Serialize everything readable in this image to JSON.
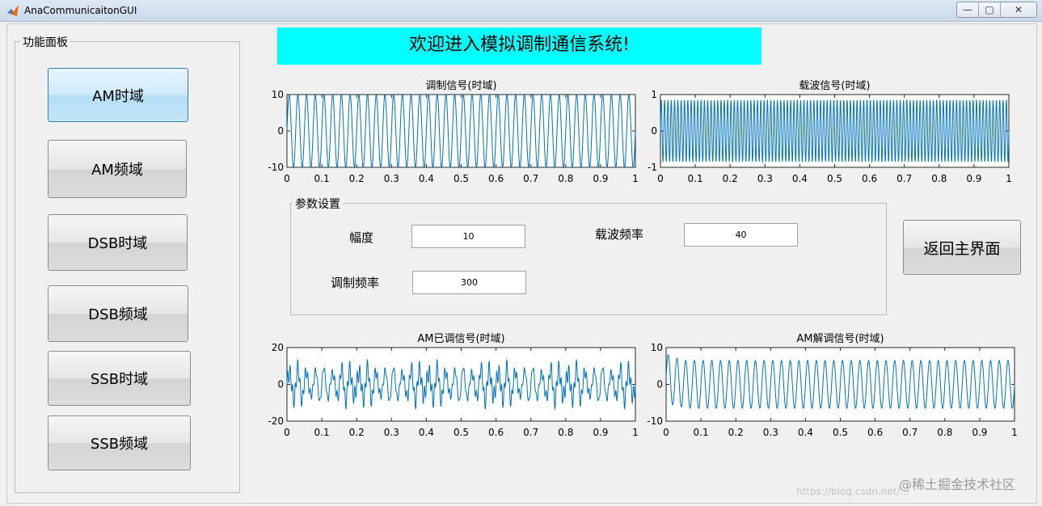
{
  "window": {
    "title": "AnaCommunicaitonGUI",
    "controls": [
      "—",
      "▢",
      "✕"
    ]
  },
  "function_panel": {
    "title": "功能面板",
    "buttons": [
      {
        "label": "AM时域",
        "active": true
      },
      {
        "label": "AM频域",
        "active": false
      },
      {
        "label": "DSB时域",
        "active": false
      },
      {
        "label": "DSB频域",
        "active": false
      },
      {
        "label": "SSB时域",
        "active": false
      },
      {
        "label": "SSB频域",
        "active": false
      }
    ]
  },
  "banner": {
    "text": "欢迎进入模拟调制通信系统!",
    "color": "#00ffff"
  },
  "params": {
    "title": "参数设置",
    "amplitude_label": "幅度",
    "amplitude_value": "10",
    "carrier_freq_label": "载波频率",
    "carrier_freq_value": "40",
    "mod_freq_label": "调制频率",
    "mod_freq_value": "300"
  },
  "return_button": {
    "label": "返回主界面"
  },
  "chart_data": [
    {
      "type": "line",
      "title": "调制信号(时域)",
      "xlim": [
        0,
        1
      ],
      "ylim": [
        -10,
        10
      ],
      "xticks": [
        "0",
        "0.1",
        "0.2",
        "0.3",
        "0.4",
        "0.5",
        "0.6",
        "0.7",
        "0.8",
        "0.9",
        "1"
      ],
      "yticks": [
        "10",
        "0",
        "-10"
      ],
      "series": [
        {
          "color": "#0072bd",
          "amplitude": 10,
          "cycles": 40
        }
      ]
    },
    {
      "type": "line",
      "title": "载波信号(时域)",
      "xlim": [
        0,
        1
      ],
      "ylim": [
        -1,
        1
      ],
      "xticks": [
        "0",
        "0.1",
        "0.2",
        "0.3",
        "0.4",
        "0.5",
        "0.6",
        "0.7",
        "0.8",
        "0.9",
        "1"
      ],
      "yticks": [
        "1",
        "0",
        "-1"
      ],
      "series": [
        {
          "color": "#0072bd",
          "amplitude": 0.85,
          "cycles": 105
        }
      ]
    },
    {
      "type": "line",
      "title": "AM已调信号(时域)",
      "xlim": [
        0,
        1
      ],
      "ylim": [
        -20,
        20
      ],
      "xticks": [
        "0",
        "0.1",
        "0.2",
        "0.3",
        "0.4",
        "0.5",
        "0.6",
        "0.7",
        "0.8",
        "0.9",
        "1"
      ],
      "yticks": [
        "20",
        "0",
        "-20"
      ],
      "series": [
        {
          "color": "#0072bd"
        }
      ]
    },
    {
      "type": "line",
      "title": "AM解调信号(时域)",
      "xlim": [
        0,
        1
      ],
      "ylim": [
        -10,
        10
      ],
      "xticks": [
        "0",
        "0.1",
        "0.2",
        "0.3",
        "0.4",
        "0.5",
        "0.6",
        "0.7",
        "0.8",
        "0.9",
        "1"
      ],
      "yticks": [
        "10",
        "0",
        "-10"
      ],
      "series": [
        {
          "color": "#0072bd",
          "amplitude": 6.5,
          "cycles": 40
        }
      ]
    }
  ],
  "watermark": {
    "text": "@稀土掘金技术社区",
    "sub": "https://blog.csdn.net/..."
  }
}
